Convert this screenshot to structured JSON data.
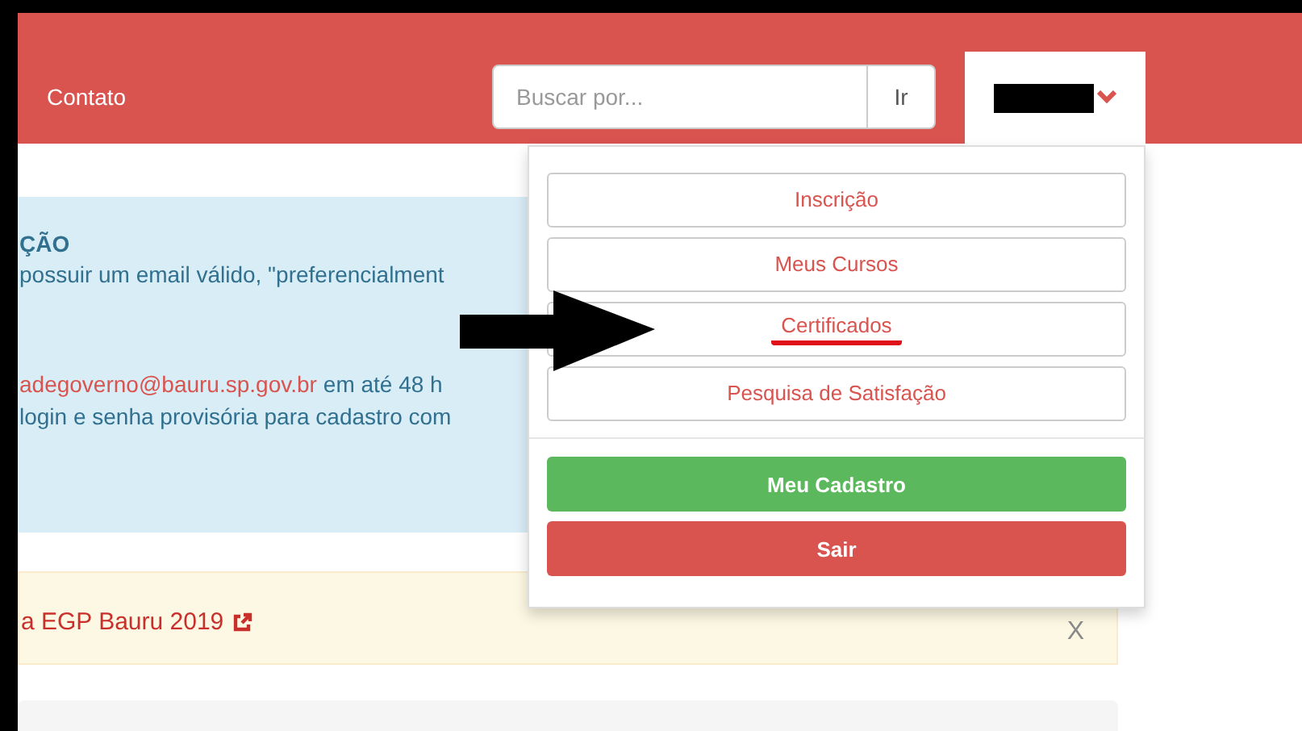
{
  "header": {
    "nav_link": "Contato",
    "search": {
      "placeholder": "Buscar por...",
      "button": "Ir"
    }
  },
  "user_menu": {
    "expanded": true,
    "items": [
      {
        "label": "Inscrição",
        "highlighted": false
      },
      {
        "label": "Meus Cursos",
        "highlighted": false
      },
      {
        "label": "Certificados",
        "highlighted": true
      },
      {
        "label": "Pesquisa de Satisfação",
        "highlighted": false
      }
    ],
    "buttons": [
      {
        "label": "Meu Cadastro",
        "kind": "success"
      },
      {
        "label": "Sair",
        "kind": "danger"
      }
    ]
  },
  "info_alert": {
    "heading": "ÇÃO",
    "line_1": "possuir um email válido, \"preferencialment",
    "email": "adegoverno@bauru.sp.gov.br",
    "line_2": "em até 48 h",
    "line_3": "login e senha provisória para cadastro com"
  },
  "warning_alert": {
    "link": "a EGP Bauru 2019",
    "close": "X"
  }
}
